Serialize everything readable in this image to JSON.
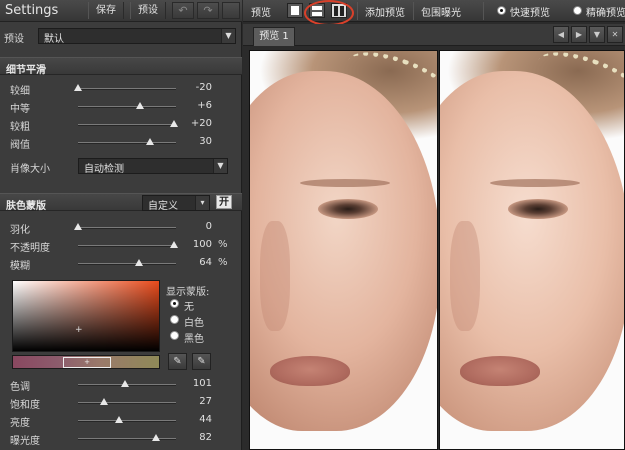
{
  "left": {
    "app_title": "Settings",
    "save_label": "保存",
    "preset_label": "预设",
    "preset_row_label": "预设",
    "preset_value": "默认",
    "detail_section": "细节平滑",
    "sliders_detail": [
      {
        "label": "较细",
        "value": "-20",
        "fraction": 0.0
      },
      {
        "label": "中等",
        "value": "+6",
        "fraction": 0.63
      },
      {
        "label": "较粗",
        "value": "+20",
        "fraction": 0.98
      },
      {
        "label": "阀值",
        "value": "30",
        "fraction": 0.73
      }
    ],
    "portrait_size_label": "肖像大小",
    "portrait_size_value": "自动检测",
    "skin_section": "肤色蒙版",
    "skin_mode": "自定义",
    "skin_toggle": "开",
    "sliders_skin": [
      {
        "label": "羽化",
        "value": "0",
        "unit": "",
        "fraction": 0.0
      },
      {
        "label": "不透明度",
        "value": "100",
        "unit": "%",
        "fraction": 0.98
      },
      {
        "label": "模糊",
        "value": "64",
        "unit": "%",
        "fraction": 0.62
      }
    ],
    "show_mask_label": "显示蒙版:",
    "mask_options": [
      "无",
      "白色",
      "黑色"
    ],
    "mask_selected": 0,
    "sliders_color": [
      {
        "label": "色调",
        "value": "101",
        "fraction": 0.48
      },
      {
        "label": "饱和度",
        "value": "27",
        "fraction": 0.27
      },
      {
        "label": "亮度",
        "value": "44",
        "fraction": 0.42
      },
      {
        "label": "曝光度",
        "value": "82",
        "fraction": 0.8
      }
    ]
  },
  "right": {
    "preview_label": "预览",
    "add_preview": "添加预览",
    "bracket_label": "包围曝光",
    "fast_preview": "快速预览",
    "accurate_preview": "精确预览",
    "tab_label": "预览 1"
  }
}
